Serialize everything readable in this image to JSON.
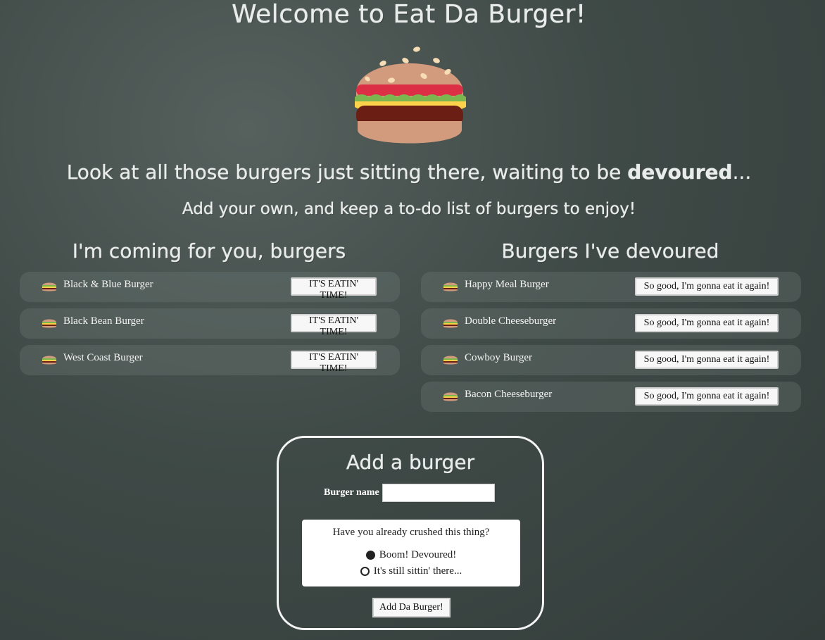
{
  "header": {
    "title": "Welcome to Eat Da Burger!",
    "subtitle_pre": "Look at all those burgers just sitting there, waiting to be ",
    "subtitle_bold": "devoured",
    "subtitle_post": "...",
    "subtitle2": "Add your own, and keep a to-do list of burgers to enjoy!"
  },
  "columns": {
    "left_title": "I'm coming for you, burgers",
    "right_title": "Burgers I've devoured"
  },
  "to_eat": [
    {
      "name": "Black & Blue Burger",
      "action": "IT'S EATIN' TIME!"
    },
    {
      "name": "Black Bean Burger",
      "action": "IT'S EATIN' TIME!"
    },
    {
      "name": "West Coast Burger",
      "action": "IT'S EATIN' TIME!"
    }
  ],
  "devoured": [
    {
      "name": "Happy Meal Burger",
      "action": "So good, I'm gonna eat it again!"
    },
    {
      "name": "Double Cheeseburger",
      "action": "So good, I'm gonna eat it again!"
    },
    {
      "name": "Cowboy Burger",
      "action": "So good, I'm gonna eat it again!"
    },
    {
      "name": "Bacon Cheeseburger",
      "action": "So good, I'm gonna eat it again!"
    }
  ],
  "form": {
    "title": "Add a burger",
    "name_label": "Burger name",
    "name_value": "",
    "question": "Have you already crushed this thing?",
    "option_devoured": "Boom! Devoured!",
    "option_waiting": "It's still sittin' there...",
    "selected": "devoured",
    "submit_label": "Add Da Burger!"
  },
  "colors": {
    "background": "#3f4a47",
    "row_bg": "rgba(110,120,118,0.35)",
    "button_bg": "#f7f7f7"
  },
  "icons": {
    "hero": "hamburger-icon",
    "row": "hamburger-icon"
  }
}
